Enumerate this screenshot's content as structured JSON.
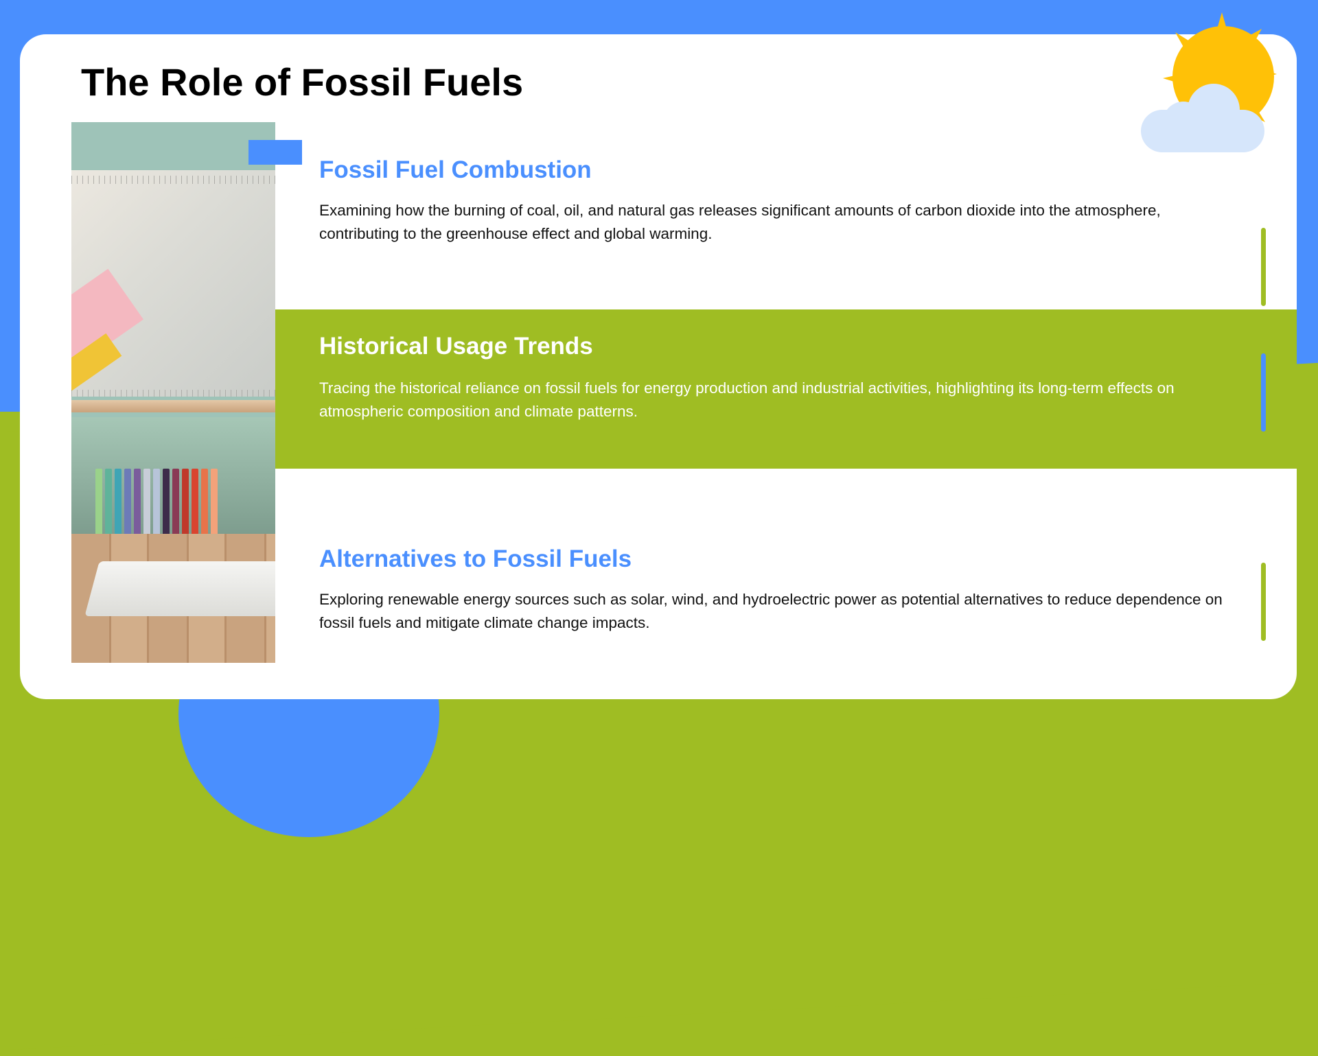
{
  "slide": {
    "title": "The Role of Fossil Fuels"
  },
  "sections": [
    {
      "heading": "Fossil Fuel Combustion",
      "description": "Examining how the burning of coal, oil, and natural gas releases significant amounts of carbon dioxide into the atmosphere, contributing to the greenhouse effect and global warming."
    },
    {
      "heading": "Historical Usage Trends",
      "description": "Tracing the historical reliance on fossil fuels for energy production and industrial activities, highlighting its long-term effects on atmospheric composition and climate patterns."
    },
    {
      "heading": "Alternatives to Fossil Fuels",
      "description": "Exploring renewable energy sources such as solar, wind, and hydroelectric power as potential alternatives to reduce dependence on fossil fuels and mitigate climate change impacts."
    }
  ],
  "icons": {
    "weather": "sun-behind-cloud-icon",
    "photo": "classroom-shelf-photo"
  },
  "colors": {
    "blue": "#4a8ffe",
    "green": "#9fbd23",
    "sun": "#ffc107",
    "cloud": "#d6e6fb"
  }
}
